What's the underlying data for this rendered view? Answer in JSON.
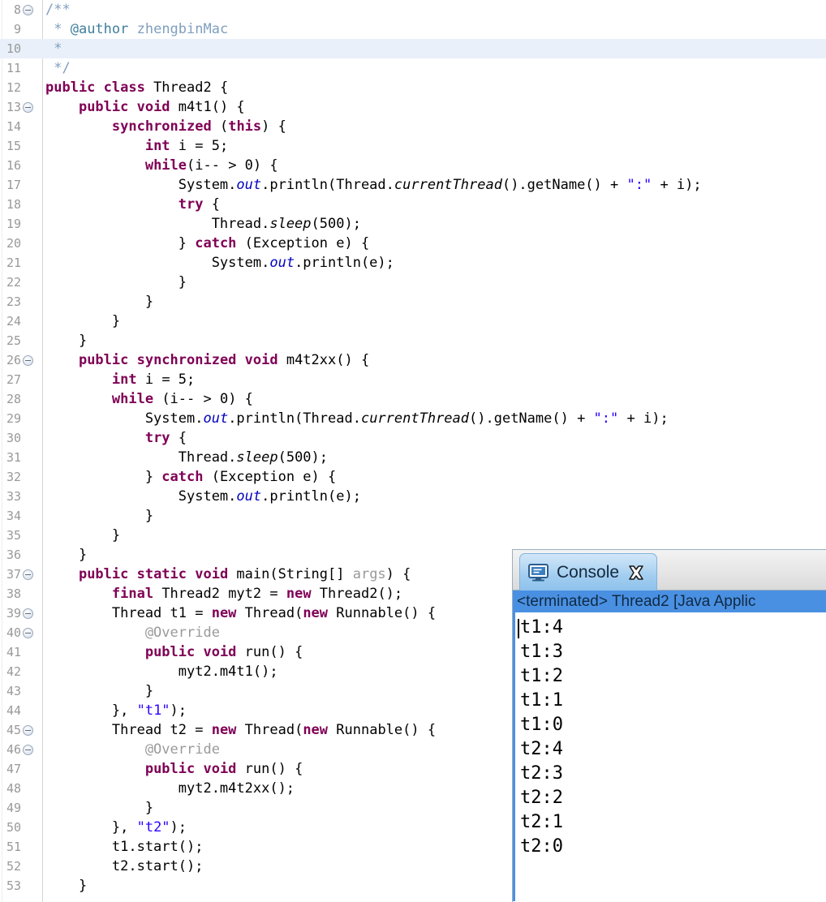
{
  "editor": {
    "name": "java-source-editor",
    "first_line_number": 8,
    "current_line_number": 10,
    "lines": [
      {
        "n": 8,
        "fold": true,
        "current": false,
        "tokens": [
          {
            "t": "/**",
            "c": "cmtt"
          }
        ]
      },
      {
        "n": 9,
        "fold": false,
        "current": false,
        "tokens": [
          {
            "t": " * ",
            "c": "cmtt"
          },
          {
            "t": "@author",
            "c": "cmt"
          },
          {
            "t": " zhengbinMac",
            "c": "cmtt"
          }
        ]
      },
      {
        "n": 10,
        "fold": false,
        "current": true,
        "tokens": [
          {
            "t": " *",
            "c": "cmtt"
          }
        ]
      },
      {
        "n": 11,
        "fold": false,
        "current": false,
        "tokens": [
          {
            "t": " */",
            "c": "cmtt"
          }
        ]
      },
      {
        "n": 12,
        "fold": false,
        "current": false,
        "tokens": [
          {
            "t": "public class",
            "c": "kw"
          },
          {
            "t": " Thread2 {",
            "c": "pln"
          }
        ]
      },
      {
        "n": 13,
        "fold": true,
        "current": false,
        "tokens": [
          {
            "t": "    ",
            "c": "pln"
          },
          {
            "t": "public void",
            "c": "kw"
          },
          {
            "t": " m4t1() {",
            "c": "pln"
          }
        ]
      },
      {
        "n": 14,
        "fold": false,
        "current": false,
        "tokens": [
          {
            "t": "        ",
            "c": "pln"
          },
          {
            "t": "synchronized",
            "c": "kw"
          },
          {
            "t": " (",
            "c": "pln"
          },
          {
            "t": "this",
            "c": "kw"
          },
          {
            "t": ") {",
            "c": "pln"
          }
        ]
      },
      {
        "n": 15,
        "fold": false,
        "current": false,
        "tokens": [
          {
            "t": "            ",
            "c": "pln"
          },
          {
            "t": "int",
            "c": "kw"
          },
          {
            "t": " i = 5;",
            "c": "pln"
          }
        ]
      },
      {
        "n": 16,
        "fold": false,
        "current": false,
        "tokens": [
          {
            "t": "            ",
            "c": "pln"
          },
          {
            "t": "while",
            "c": "kw"
          },
          {
            "t": "(i-- > 0) {",
            "c": "pln"
          }
        ]
      },
      {
        "n": 17,
        "fold": false,
        "current": false,
        "tokens": [
          {
            "t": "                System.",
            "c": "pln"
          },
          {
            "t": "out",
            "c": "fld"
          },
          {
            "t": ".println(Thread.",
            "c": "pln"
          },
          {
            "t": "currentThread",
            "c": "mth"
          },
          {
            "t": "().getName() + ",
            "c": "pln"
          },
          {
            "t": "\":\"",
            "c": "str"
          },
          {
            "t": " + i);",
            "c": "pln"
          }
        ]
      },
      {
        "n": 18,
        "fold": false,
        "current": false,
        "tokens": [
          {
            "t": "                ",
            "c": "pln"
          },
          {
            "t": "try",
            "c": "kw"
          },
          {
            "t": " {",
            "c": "pln"
          }
        ]
      },
      {
        "n": 19,
        "fold": false,
        "current": false,
        "tokens": [
          {
            "t": "                    Thread.",
            "c": "pln"
          },
          {
            "t": "sleep",
            "c": "mth"
          },
          {
            "t": "(500);",
            "c": "pln"
          }
        ]
      },
      {
        "n": 20,
        "fold": false,
        "current": false,
        "tokens": [
          {
            "t": "                } ",
            "c": "pln"
          },
          {
            "t": "catch",
            "c": "kw"
          },
          {
            "t": " (Exception e) {",
            "c": "pln"
          }
        ]
      },
      {
        "n": 21,
        "fold": false,
        "current": false,
        "tokens": [
          {
            "t": "                    System.",
            "c": "pln"
          },
          {
            "t": "out",
            "c": "fld"
          },
          {
            "t": ".println(e);",
            "c": "pln"
          }
        ]
      },
      {
        "n": 22,
        "fold": false,
        "current": false,
        "tokens": [
          {
            "t": "                }",
            "c": "pln"
          }
        ]
      },
      {
        "n": 23,
        "fold": false,
        "current": false,
        "tokens": [
          {
            "t": "            }",
            "c": "pln"
          }
        ]
      },
      {
        "n": 24,
        "fold": false,
        "current": false,
        "tokens": [
          {
            "t": "        }",
            "c": "pln"
          }
        ]
      },
      {
        "n": 25,
        "fold": false,
        "current": false,
        "tokens": [
          {
            "t": "    }",
            "c": "pln"
          }
        ]
      },
      {
        "n": 26,
        "fold": true,
        "current": false,
        "tokens": [
          {
            "t": "    ",
            "c": "pln"
          },
          {
            "t": "public synchronized void",
            "c": "kw"
          },
          {
            "t": " m4t2xx() {",
            "c": "pln"
          }
        ]
      },
      {
        "n": 27,
        "fold": false,
        "current": false,
        "tokens": [
          {
            "t": "        ",
            "c": "pln"
          },
          {
            "t": "int",
            "c": "kw"
          },
          {
            "t": " i = 5;",
            "c": "pln"
          }
        ]
      },
      {
        "n": 28,
        "fold": false,
        "current": false,
        "tokens": [
          {
            "t": "        ",
            "c": "pln"
          },
          {
            "t": "while",
            "c": "kw"
          },
          {
            "t": " (i-- > 0) {",
            "c": "pln"
          }
        ]
      },
      {
        "n": 29,
        "fold": false,
        "current": false,
        "tokens": [
          {
            "t": "            System.",
            "c": "pln"
          },
          {
            "t": "out",
            "c": "fld"
          },
          {
            "t": ".println(Thread.",
            "c": "pln"
          },
          {
            "t": "currentThread",
            "c": "mth"
          },
          {
            "t": "().getName() + ",
            "c": "pln"
          },
          {
            "t": "\":\"",
            "c": "str"
          },
          {
            "t": " + i);",
            "c": "pln"
          }
        ]
      },
      {
        "n": 30,
        "fold": false,
        "current": false,
        "tokens": [
          {
            "t": "            ",
            "c": "pln"
          },
          {
            "t": "try",
            "c": "kw"
          },
          {
            "t": " {",
            "c": "pln"
          }
        ]
      },
      {
        "n": 31,
        "fold": false,
        "current": false,
        "tokens": [
          {
            "t": "                Thread.",
            "c": "pln"
          },
          {
            "t": "sleep",
            "c": "mth"
          },
          {
            "t": "(500);",
            "c": "pln"
          }
        ]
      },
      {
        "n": 32,
        "fold": false,
        "current": false,
        "tokens": [
          {
            "t": "            } ",
            "c": "pln"
          },
          {
            "t": "catch",
            "c": "kw"
          },
          {
            "t": " (Exception e) {",
            "c": "pln"
          }
        ]
      },
      {
        "n": 33,
        "fold": false,
        "current": false,
        "tokens": [
          {
            "t": "                System.",
            "c": "pln"
          },
          {
            "t": "out",
            "c": "fld"
          },
          {
            "t": ".println(e);",
            "c": "pln"
          }
        ]
      },
      {
        "n": 34,
        "fold": false,
        "current": false,
        "tokens": [
          {
            "t": "            }",
            "c": "pln"
          }
        ]
      },
      {
        "n": 35,
        "fold": false,
        "current": false,
        "tokens": [
          {
            "t": "        }",
            "c": "pln"
          }
        ]
      },
      {
        "n": 36,
        "fold": false,
        "current": false,
        "tokens": [
          {
            "t": "    }",
            "c": "pln"
          }
        ]
      },
      {
        "n": 37,
        "fold": true,
        "current": false,
        "tokens": [
          {
            "t": "    ",
            "c": "pln"
          },
          {
            "t": "public static void",
            "c": "kw"
          },
          {
            "t": " main(String[] ",
            "c": "pln"
          },
          {
            "t": "args",
            "c": "ann"
          },
          {
            "t": ") {",
            "c": "pln"
          }
        ]
      },
      {
        "n": 38,
        "fold": false,
        "current": false,
        "tokens": [
          {
            "t": "        ",
            "c": "pln"
          },
          {
            "t": "final",
            "c": "kw"
          },
          {
            "t": " Thread2 myt2 = ",
            "c": "pln"
          },
          {
            "t": "new",
            "c": "kw"
          },
          {
            "t": " Thread2();",
            "c": "pln"
          }
        ]
      },
      {
        "n": 39,
        "fold": true,
        "current": false,
        "tokens": [
          {
            "t": "        Thread t1 = ",
            "c": "pln"
          },
          {
            "t": "new",
            "c": "kw"
          },
          {
            "t": " Thread(",
            "c": "pln"
          },
          {
            "t": "new",
            "c": "kw"
          },
          {
            "t": " Runnable() {",
            "c": "pln"
          }
        ]
      },
      {
        "n": 40,
        "fold": true,
        "current": false,
        "tokens": [
          {
            "t": "            @Override",
            "c": "ann"
          }
        ]
      },
      {
        "n": 41,
        "fold": false,
        "current": false,
        "tokens": [
          {
            "t": "            ",
            "c": "pln"
          },
          {
            "t": "public void",
            "c": "kw"
          },
          {
            "t": " run() {",
            "c": "pln"
          }
        ]
      },
      {
        "n": 42,
        "fold": false,
        "current": false,
        "tokens": [
          {
            "t": "                myt2.m4t1();",
            "c": "pln"
          }
        ]
      },
      {
        "n": 43,
        "fold": false,
        "current": false,
        "tokens": [
          {
            "t": "            }",
            "c": "pln"
          }
        ]
      },
      {
        "n": 44,
        "fold": false,
        "current": false,
        "tokens": [
          {
            "t": "        }, ",
            "c": "pln"
          },
          {
            "t": "\"t1\"",
            "c": "str"
          },
          {
            "t": ");",
            "c": "pln"
          }
        ]
      },
      {
        "n": 45,
        "fold": true,
        "current": false,
        "tokens": [
          {
            "t": "        Thread t2 = ",
            "c": "pln"
          },
          {
            "t": "new",
            "c": "kw"
          },
          {
            "t": " Thread(",
            "c": "pln"
          },
          {
            "t": "new",
            "c": "kw"
          },
          {
            "t": " Runnable() {",
            "c": "pln"
          }
        ]
      },
      {
        "n": 46,
        "fold": true,
        "current": false,
        "tokens": [
          {
            "t": "            @Override",
            "c": "ann"
          }
        ]
      },
      {
        "n": 47,
        "fold": false,
        "current": false,
        "tokens": [
          {
            "t": "            ",
            "c": "pln"
          },
          {
            "t": "public void",
            "c": "kw"
          },
          {
            "t": " run() {",
            "c": "pln"
          }
        ]
      },
      {
        "n": 48,
        "fold": false,
        "current": false,
        "tokens": [
          {
            "t": "                myt2.m4t2xx();",
            "c": "pln"
          }
        ]
      },
      {
        "n": 49,
        "fold": false,
        "current": false,
        "tokens": [
          {
            "t": "            }",
            "c": "pln"
          }
        ]
      },
      {
        "n": 50,
        "fold": false,
        "current": false,
        "tokens": [
          {
            "t": "        }, ",
            "c": "pln"
          },
          {
            "t": "\"t2\"",
            "c": "str"
          },
          {
            "t": ");",
            "c": "pln"
          }
        ]
      },
      {
        "n": 51,
        "fold": false,
        "current": false,
        "tokens": [
          {
            "t": "        t1.start();",
            "c": "pln"
          }
        ]
      },
      {
        "n": 52,
        "fold": false,
        "current": false,
        "tokens": [
          {
            "t": "        t2.start();",
            "c": "pln"
          }
        ]
      },
      {
        "n": 53,
        "fold": false,
        "current": false,
        "tokens": [
          {
            "t": "    }",
            "c": "pln"
          }
        ]
      }
    ]
  },
  "console": {
    "tab_label": "Console",
    "tab_icon": "monitor-icon",
    "close_icon": "close-icon",
    "status_line": "<terminated> Thread2 [Java Applic",
    "output_lines": [
      "t1:4",
      "t1:3",
      "t1:2",
      "t1:1",
      "t1:0",
      "t2:4",
      "t2:3",
      "t2:2",
      "t2:1",
      "t2:0"
    ]
  },
  "colors": {
    "keyword": "#7f0055",
    "string": "#2a00ff",
    "comment": "#3f7f9f",
    "javadoc": "#7f9fbf",
    "field": "#0000c0",
    "annotation": "#9a9a9a",
    "current_line_bg": "#e9f0fa",
    "console_selection": "#4a90e2",
    "tab_active": "#a2cdf0"
  }
}
